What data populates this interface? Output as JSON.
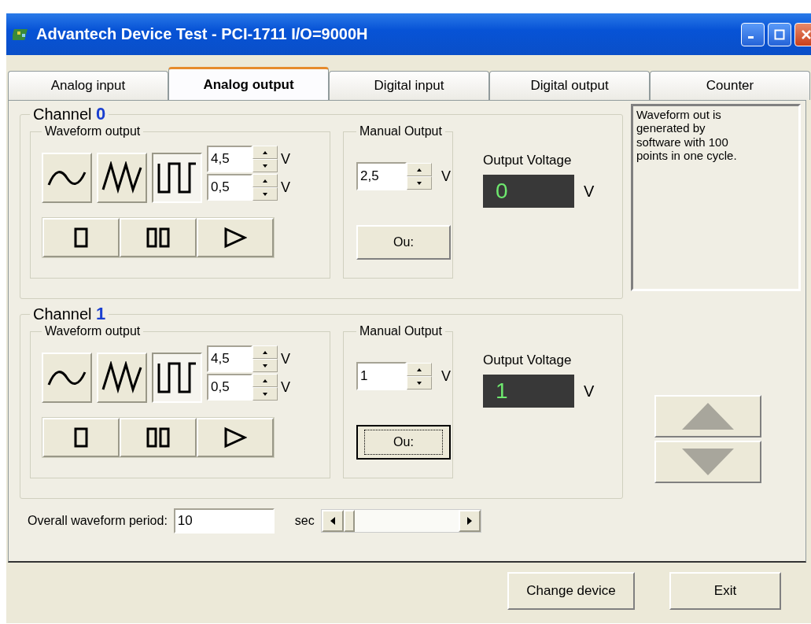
{
  "window": {
    "title": "Advantech Device Test - PCI-1711 I/O=9000H"
  },
  "tabs": [
    {
      "label": "Analog input",
      "selected": false
    },
    {
      "label": "Analog output",
      "selected": true
    },
    {
      "label": "Digital input",
      "selected": false
    },
    {
      "label": "Digital output",
      "selected": false
    },
    {
      "label": "Counter",
      "selected": false
    }
  ],
  "channels": [
    {
      "label": "Channel",
      "number": "0",
      "waveform": {
        "title": "Waveform output",
        "shapes": [
          {
            "kind": "sine",
            "selected": false
          },
          {
            "kind": "triangle",
            "selected": false
          },
          {
            "kind": "square",
            "selected": true
          }
        ],
        "limits": [
          {
            "value": "4,5",
            "unit": "V"
          },
          {
            "value": "0,5",
            "unit": "V"
          }
        ],
        "controls": [
          {
            "kind": "stop"
          },
          {
            "kind": "pause"
          },
          {
            "kind": "play"
          }
        ]
      },
      "manual": {
        "title": "Manual Output",
        "value": "2,5",
        "unit": "V",
        "button": "Ou:",
        "focused": false
      },
      "output": {
        "label": "Output Voltage",
        "reading": "0",
        "unit": "V"
      }
    },
    {
      "label": "Channel",
      "number": "1",
      "waveform": {
        "title": "Waveform output",
        "shapes": [
          {
            "kind": "sine",
            "selected": false
          },
          {
            "kind": "triangle",
            "selected": false
          },
          {
            "kind": "square",
            "selected": true
          }
        ],
        "limits": [
          {
            "value": "4,5",
            "unit": "V"
          },
          {
            "value": "0,5",
            "unit": "V"
          }
        ],
        "controls": [
          {
            "kind": "stop"
          },
          {
            "kind": "pause"
          },
          {
            "kind": "play"
          }
        ]
      },
      "manual": {
        "title": "Manual Output",
        "value": "1",
        "unit": "V",
        "button": "Ou:",
        "focused": true
      },
      "output": {
        "label": "Output Voltage",
        "reading": "1",
        "unit": "V"
      }
    }
  ],
  "description": "Waveform out is generated by software with 100 points in one cycle.",
  "scroll_buttons": [
    {
      "kind": "up",
      "disabled": true
    },
    {
      "kind": "down",
      "disabled": true
    }
  ],
  "period": {
    "label": "Overall waveform period:",
    "value": "10",
    "unit": "sec"
  },
  "buttons": [
    "Change device",
    "Exit"
  ]
}
